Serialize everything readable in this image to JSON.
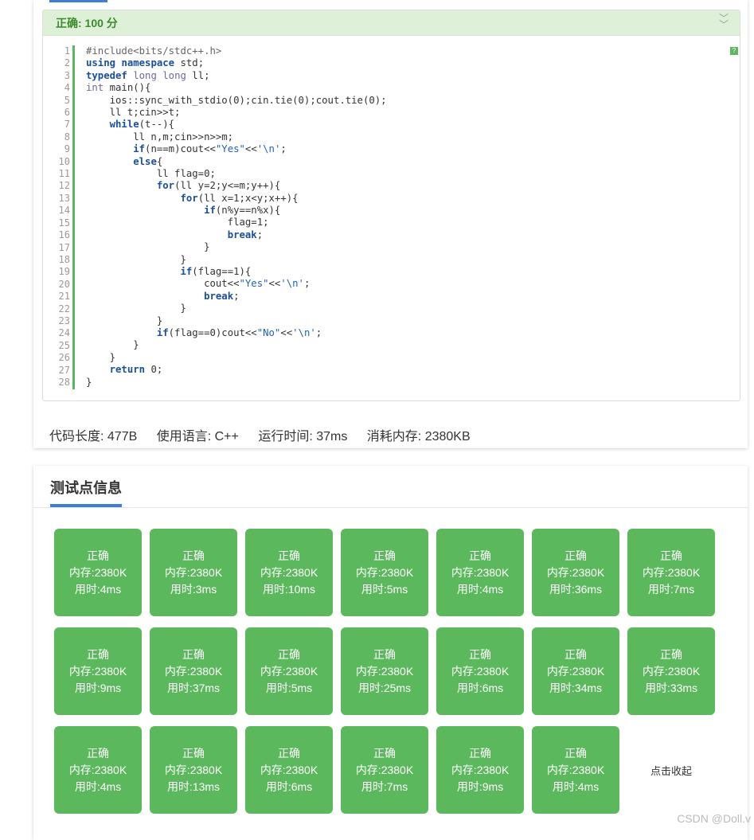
{
  "result": {
    "status": "正确:   100 分"
  },
  "code": {
    "lines": [
      "#include<bits/stdc++.h>",
      "using namespace std;",
      "typedef long long ll;",
      "int main(){",
      "    ios::sync_with_stdio(0);cin.tie(0);cout.tie(0);",
      "    ll t;cin>>t;",
      "    while(t--){",
      "        ll n,m;cin>>n>>m;",
      "        if(n==m)cout<<\"Yes\"<<'\\n';",
      "        else{",
      "            ll flag=0;",
      "            for(ll y=2;y<=m;y++){",
      "                for(ll x=1;x<y;x++){",
      "                    if(n%y==n%x){",
      "                        flag=1;",
      "                        break;",
      "                    }",
      "                }",
      "                if(flag==1){",
      "                    cout<<\"Yes\"<<'\\n';",
      "                    break;",
      "                }",
      "            }",
      "            if(flag==0)cout<<\"No\"<<'\\n';",
      "        }",
      "    }",
      "    return 0;",
      "}"
    ]
  },
  "meta": {
    "code_length": "代码长度: 477B",
    "language": "使用语言: C++",
    "run_time": "运行时间: 37ms",
    "memory": "消耗内存: 2380KB"
  },
  "testpoints": {
    "title": "测试点信息",
    "collapse_label": "点击收起",
    "items": [
      {
        "status": "正确",
        "memory": "内存:2380K",
        "time": "用时:4ms"
      },
      {
        "status": "正确",
        "memory": "内存:2380K",
        "time": "用时:3ms"
      },
      {
        "status": "正确",
        "memory": "内存:2380K",
        "time": "用时:10ms"
      },
      {
        "status": "正确",
        "memory": "内存:2380K",
        "time": "用时:5ms"
      },
      {
        "status": "正确",
        "memory": "内存:2380K",
        "time": "用时:4ms"
      },
      {
        "status": "正确",
        "memory": "内存:2380K",
        "time": "用时:36ms"
      },
      {
        "status": "正确",
        "memory": "内存:2380K",
        "time": "用时:7ms"
      },
      {
        "status": "正确",
        "memory": "内存:2380K",
        "time": "用时:9ms"
      },
      {
        "status": "正确",
        "memory": "内存:2380K",
        "time": "用时:37ms"
      },
      {
        "status": "正确",
        "memory": "内存:2380K",
        "time": "用时:5ms"
      },
      {
        "status": "正确",
        "memory": "内存:2380K",
        "time": "用时:25ms"
      },
      {
        "status": "正确",
        "memory": "内存:2380K",
        "time": "用时:6ms"
      },
      {
        "status": "正确",
        "memory": "内存:2380K",
        "time": "用时:34ms"
      },
      {
        "status": "正确",
        "memory": "内存:2380K",
        "time": "用时:33ms"
      },
      {
        "status": "正确",
        "memory": "内存:2380K",
        "time": "用时:4ms"
      },
      {
        "status": "正确",
        "memory": "内存:2380K",
        "time": "用时:13ms"
      },
      {
        "status": "正确",
        "memory": "内存:2380K",
        "time": "用时:6ms"
      },
      {
        "status": "正确",
        "memory": "内存:2380K",
        "time": "用时:7ms"
      },
      {
        "status": "正确",
        "memory": "内存:2380K",
        "time": "用时:9ms"
      },
      {
        "status": "正确",
        "memory": "内存:2380K",
        "time": "用时:4ms"
      }
    ]
  },
  "watermark": "CSDN @Doll.v",
  "colors": {
    "accent": "#3e7dd8",
    "success": "#5cb85c",
    "success_bg": "#dff0d8"
  },
  "icons": {
    "collapse": "chevron-double-down-icon",
    "copy": "copy-icon"
  }
}
